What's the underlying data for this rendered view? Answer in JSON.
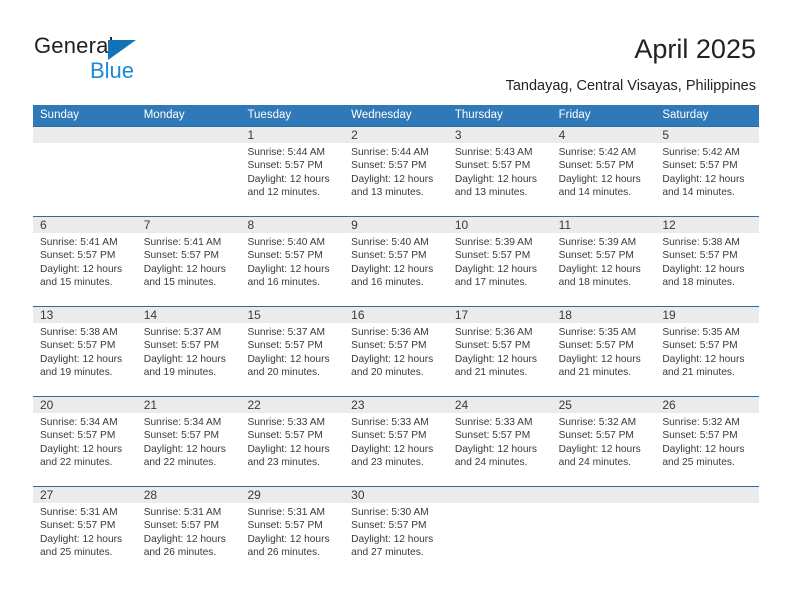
{
  "brand": {
    "name_part1": "General",
    "name_part2": "Blue"
  },
  "header": {
    "title": "April 2025",
    "location": "Tandayag, Central Visayas, Philippines"
  },
  "colors": {
    "header_blue": "#3079b8",
    "row_rule_blue": "#2d6da6",
    "daynum_band": "#ebebeb",
    "logo_blue": "#1b8ad6",
    "text": "#3a3a3a"
  },
  "weekday_headers": [
    "Sunday",
    "Monday",
    "Tuesday",
    "Wednesday",
    "Thursday",
    "Friday",
    "Saturday"
  ],
  "weeks": [
    [
      {
        "day": "",
        "sunrise": "",
        "sunset": "",
        "daylight": ""
      },
      {
        "day": "",
        "sunrise": "",
        "sunset": "",
        "daylight": ""
      },
      {
        "day": "1",
        "sunrise": "Sunrise: 5:44 AM",
        "sunset": "Sunset: 5:57 PM",
        "daylight": "Daylight: 12 hours and 12 minutes."
      },
      {
        "day": "2",
        "sunrise": "Sunrise: 5:44 AM",
        "sunset": "Sunset: 5:57 PM",
        "daylight": "Daylight: 12 hours and 13 minutes."
      },
      {
        "day": "3",
        "sunrise": "Sunrise: 5:43 AM",
        "sunset": "Sunset: 5:57 PM",
        "daylight": "Daylight: 12 hours and 13 minutes."
      },
      {
        "day": "4",
        "sunrise": "Sunrise: 5:42 AM",
        "sunset": "Sunset: 5:57 PM",
        "daylight": "Daylight: 12 hours and 14 minutes."
      },
      {
        "day": "5",
        "sunrise": "Sunrise: 5:42 AM",
        "sunset": "Sunset: 5:57 PM",
        "daylight": "Daylight: 12 hours and 14 minutes."
      }
    ],
    [
      {
        "day": "6",
        "sunrise": "Sunrise: 5:41 AM",
        "sunset": "Sunset: 5:57 PM",
        "daylight": "Daylight: 12 hours and 15 minutes."
      },
      {
        "day": "7",
        "sunrise": "Sunrise: 5:41 AM",
        "sunset": "Sunset: 5:57 PM",
        "daylight": "Daylight: 12 hours and 15 minutes."
      },
      {
        "day": "8",
        "sunrise": "Sunrise: 5:40 AM",
        "sunset": "Sunset: 5:57 PM",
        "daylight": "Daylight: 12 hours and 16 minutes."
      },
      {
        "day": "9",
        "sunrise": "Sunrise: 5:40 AM",
        "sunset": "Sunset: 5:57 PM",
        "daylight": "Daylight: 12 hours and 16 minutes."
      },
      {
        "day": "10",
        "sunrise": "Sunrise: 5:39 AM",
        "sunset": "Sunset: 5:57 PM",
        "daylight": "Daylight: 12 hours and 17 minutes."
      },
      {
        "day": "11",
        "sunrise": "Sunrise: 5:39 AM",
        "sunset": "Sunset: 5:57 PM",
        "daylight": "Daylight: 12 hours and 18 minutes."
      },
      {
        "day": "12",
        "sunrise": "Sunrise: 5:38 AM",
        "sunset": "Sunset: 5:57 PM",
        "daylight": "Daylight: 12 hours and 18 minutes."
      }
    ],
    [
      {
        "day": "13",
        "sunrise": "Sunrise: 5:38 AM",
        "sunset": "Sunset: 5:57 PM",
        "daylight": "Daylight: 12 hours and 19 minutes."
      },
      {
        "day": "14",
        "sunrise": "Sunrise: 5:37 AM",
        "sunset": "Sunset: 5:57 PM",
        "daylight": "Daylight: 12 hours and 19 minutes."
      },
      {
        "day": "15",
        "sunrise": "Sunrise: 5:37 AM",
        "sunset": "Sunset: 5:57 PM",
        "daylight": "Daylight: 12 hours and 20 minutes."
      },
      {
        "day": "16",
        "sunrise": "Sunrise: 5:36 AM",
        "sunset": "Sunset: 5:57 PM",
        "daylight": "Daylight: 12 hours and 20 minutes."
      },
      {
        "day": "17",
        "sunrise": "Sunrise: 5:36 AM",
        "sunset": "Sunset: 5:57 PM",
        "daylight": "Daylight: 12 hours and 21 minutes."
      },
      {
        "day": "18",
        "sunrise": "Sunrise: 5:35 AM",
        "sunset": "Sunset: 5:57 PM",
        "daylight": "Daylight: 12 hours and 21 minutes."
      },
      {
        "day": "19",
        "sunrise": "Sunrise: 5:35 AM",
        "sunset": "Sunset: 5:57 PM",
        "daylight": "Daylight: 12 hours and 21 minutes."
      }
    ],
    [
      {
        "day": "20",
        "sunrise": "Sunrise: 5:34 AM",
        "sunset": "Sunset: 5:57 PM",
        "daylight": "Daylight: 12 hours and 22 minutes."
      },
      {
        "day": "21",
        "sunrise": "Sunrise: 5:34 AM",
        "sunset": "Sunset: 5:57 PM",
        "daylight": "Daylight: 12 hours and 22 minutes."
      },
      {
        "day": "22",
        "sunrise": "Sunrise: 5:33 AM",
        "sunset": "Sunset: 5:57 PM",
        "daylight": "Daylight: 12 hours and 23 minutes."
      },
      {
        "day": "23",
        "sunrise": "Sunrise: 5:33 AM",
        "sunset": "Sunset: 5:57 PM",
        "daylight": "Daylight: 12 hours and 23 minutes."
      },
      {
        "day": "24",
        "sunrise": "Sunrise: 5:33 AM",
        "sunset": "Sunset: 5:57 PM",
        "daylight": "Daylight: 12 hours and 24 minutes."
      },
      {
        "day": "25",
        "sunrise": "Sunrise: 5:32 AM",
        "sunset": "Sunset: 5:57 PM",
        "daylight": "Daylight: 12 hours and 24 minutes."
      },
      {
        "day": "26",
        "sunrise": "Sunrise: 5:32 AM",
        "sunset": "Sunset: 5:57 PM",
        "daylight": "Daylight: 12 hours and 25 minutes."
      }
    ],
    [
      {
        "day": "27",
        "sunrise": "Sunrise: 5:31 AM",
        "sunset": "Sunset: 5:57 PM",
        "daylight": "Daylight: 12 hours and 25 minutes."
      },
      {
        "day": "28",
        "sunrise": "Sunrise: 5:31 AM",
        "sunset": "Sunset: 5:57 PM",
        "daylight": "Daylight: 12 hours and 26 minutes."
      },
      {
        "day": "29",
        "sunrise": "Sunrise: 5:31 AM",
        "sunset": "Sunset: 5:57 PM",
        "daylight": "Daylight: 12 hours and 26 minutes."
      },
      {
        "day": "30",
        "sunrise": "Sunrise: 5:30 AM",
        "sunset": "Sunset: 5:57 PM",
        "daylight": "Daylight: 12 hours and 27 minutes."
      },
      {
        "day": "",
        "sunrise": "",
        "sunset": "",
        "daylight": ""
      },
      {
        "day": "",
        "sunrise": "",
        "sunset": "",
        "daylight": ""
      },
      {
        "day": "",
        "sunrise": "",
        "sunset": "",
        "daylight": ""
      }
    ]
  ]
}
